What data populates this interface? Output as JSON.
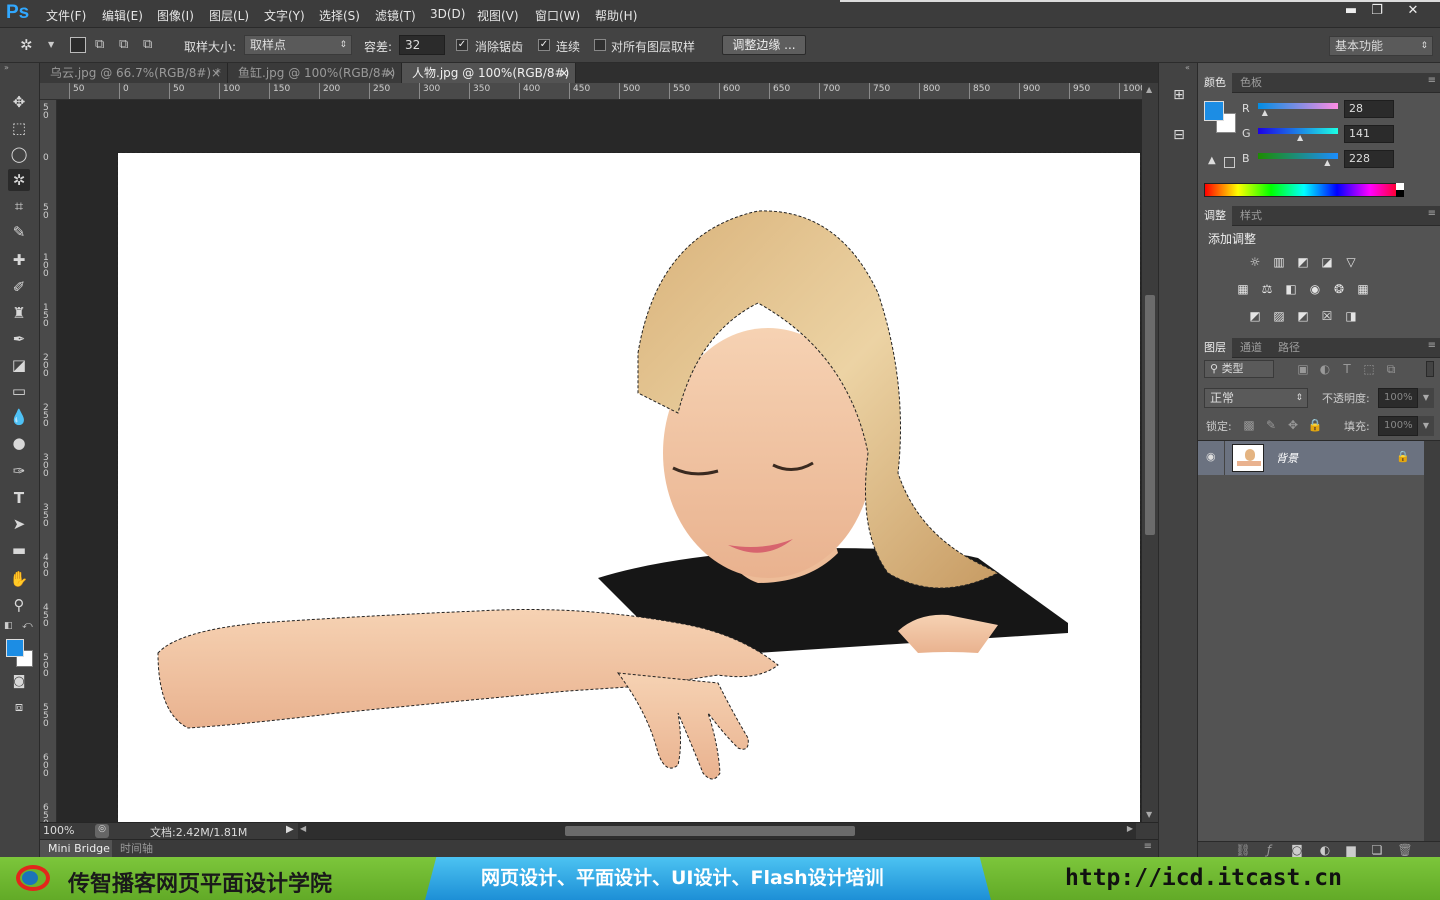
{
  "app": {
    "logo": "Ps"
  },
  "menu": [
    "文件(F)",
    "编辑(E)",
    "图像(I)",
    "图层(L)",
    "文字(Y)",
    "选择(S)",
    "滤镜(T)",
    "3D(D)",
    "视图(V)",
    "窗口(W)",
    "帮助(H)"
  ],
  "window_controls": {
    "minimize": "▬",
    "restore": "❐",
    "close": "✕"
  },
  "options": {
    "sample_size_label": "取样大小:",
    "sample_size_value": "取样点",
    "tolerance_label": "容差:",
    "tolerance_value": "32",
    "antialias_label": "消除锯齿",
    "antialias_checked": true,
    "contiguous_label": "连续",
    "contiguous_checked": true,
    "sample_all_label": "对所有图层取样",
    "sample_all_checked": false,
    "refine_edge_label": "调整边缘 ...",
    "workspace_value": "基本功能"
  },
  "tabs": [
    {
      "label": "乌云.jpg @ 66.7%(RGB/8#) *",
      "active": false
    },
    {
      "label": "鱼缸.jpg @ 100%(RGB/8#)",
      "active": false
    },
    {
      "label": "人物.jpg @ 100%(RGB/8#)",
      "active": true
    }
  ],
  "tab_close": "×",
  "hruler": [
    "50",
    "0",
    "50",
    "100",
    "150",
    "200",
    "250",
    "300",
    "350",
    "400",
    "450",
    "500",
    "550",
    "600",
    "650",
    "700",
    "750",
    "800",
    "850",
    "900",
    "950",
    "1000"
  ],
  "vruler": [
    "50",
    "0",
    "50",
    "100",
    "150",
    "200",
    "250",
    "300",
    "350",
    "400",
    "450",
    "500",
    "550",
    "600",
    "650"
  ],
  "tools": [
    "move-tool",
    "marquee-tool",
    "lasso-tool",
    "magic-wand-tool",
    "crop-tool",
    "eyedropper-tool",
    "healing-brush-tool",
    "brush-tool",
    "clone-stamp-tool",
    "history-brush-tool",
    "eraser-tool",
    "gradient-tool",
    "blur-tool",
    "dodge-tool",
    "pen-tool",
    "type-tool",
    "path-selection-tool",
    "rectangle-tool",
    "hand-tool",
    "zoom-tool"
  ],
  "status": {
    "zoom": "100%",
    "doc_info": "文档:2.42M/1.81M"
  },
  "bottom_tabs": [
    "Mini Bridge",
    "时间轴"
  ],
  "color_panel": {
    "tabs": [
      "颜色",
      "色板"
    ],
    "fg_color": "#1c8de4",
    "channels": [
      {
        "label": "R",
        "value": "28",
        "level": 0.11
      },
      {
        "label": "G",
        "value": "141",
        "level": 0.55
      },
      {
        "label": "B",
        "value": "228",
        "level": 0.89
      }
    ]
  },
  "adjust_panel": {
    "tabs": [
      "调整",
      "样式"
    ],
    "title": "添加调整"
  },
  "layers_panel": {
    "tabs": [
      "图层",
      "通道",
      "路径"
    ],
    "filter_label": "类型",
    "blend_mode": "正常",
    "opacity_label": "不透明度:",
    "opacity_value": "100%",
    "lock_label": "锁定:",
    "fill_label": "填充:",
    "fill_value": "100%",
    "layers": [
      {
        "name": "背景",
        "locked": true,
        "visible": true
      }
    ]
  },
  "banner": {
    "school": "传智播客网页平面设计学院",
    "courses": "网页设计、平面设计、UI设计、Flash设计培训",
    "url": "http://icd.itcast.cn"
  }
}
